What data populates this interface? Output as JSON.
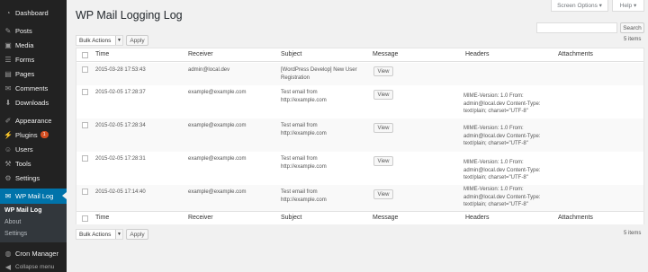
{
  "sidebar": {
    "items": [
      {
        "label": "Dashboard",
        "icon": "dashboard-icon",
        "glyph": "◔"
      },
      {
        "label": "Posts",
        "icon": "pin-icon",
        "glyph": "✎"
      },
      {
        "label": "Media",
        "icon": "media-icon",
        "glyph": "▣"
      },
      {
        "label": "Forms",
        "icon": "forms-icon",
        "glyph": "☰"
      },
      {
        "label": "Pages",
        "icon": "pages-icon",
        "glyph": "▤"
      },
      {
        "label": "Comments",
        "icon": "comments-icon",
        "glyph": "✉"
      },
      {
        "label": "Downloads",
        "icon": "download-icon",
        "glyph": "⬇"
      },
      {
        "label": "Appearance",
        "icon": "brush-icon",
        "glyph": "✐"
      },
      {
        "label": "Plugins",
        "icon": "plug-icon",
        "glyph": "⚡",
        "badge": "1"
      },
      {
        "label": "Users",
        "icon": "users-icon",
        "glyph": "☺"
      },
      {
        "label": "Tools",
        "icon": "wrench-icon",
        "glyph": "⚒"
      },
      {
        "label": "Settings",
        "icon": "settings-icon",
        "glyph": "⚙"
      },
      {
        "label": "WP Mail Log",
        "icon": "mail-icon",
        "glyph": "✉"
      },
      {
        "label": "Cron Manager",
        "icon": "globe-icon",
        "glyph": "◍"
      },
      {
        "label": "Collapse menu",
        "icon": "collapse-icon",
        "glyph": "◀"
      }
    ],
    "submenu": [
      "WP Mail Log",
      "About",
      "Settings"
    ]
  },
  "top": {
    "screen_options": "Screen Options ▾",
    "help": "Help ▾"
  },
  "page_title": "WP Mail Logging Log",
  "search_button": "Search",
  "bulk": {
    "label": "Bulk Actions",
    "apply": "Apply"
  },
  "item_count": "5 items",
  "columns": [
    "Time",
    "Receiver",
    "Subject",
    "Message",
    "Headers",
    "Attachments"
  ],
  "view_label": "View",
  "rows": [
    {
      "time": "2015-03-28 17:53:43",
      "receiver": "admin@local.dev",
      "subject": [
        "[WordPress Develop] New User",
        "Registration"
      ],
      "headers": []
    },
    {
      "time": "2015-02-05 17:28:37",
      "receiver": "example@example.com",
      "subject": [
        "Test email from",
        "http://example.com"
      ],
      "headers": [
        "MIME-Version: 1.0 From:",
        "admin@local.dev Content-Type:",
        "text/plain; charset=\"UTF-8\""
      ]
    },
    {
      "time": "2015-02-05 17:28:34",
      "receiver": "example@example.com",
      "subject": [
        "Test email from",
        "http://example.com"
      ],
      "headers": [
        "MIME-Version: 1.0 From:",
        "admin@local.dev Content-Type:",
        "text/plain; charset=\"UTF-8\""
      ]
    },
    {
      "time": "2015-02-05 17:28:31",
      "receiver": "example@example.com",
      "subject": [
        "Test email from",
        "http://example.com"
      ],
      "headers": [
        "MIME-Version: 1.0 From:",
        "admin@local.dev Content-Type:",
        "text/plain; charset=\"UTF-8\""
      ]
    },
    {
      "time": "2015-02-05 17:14:40",
      "receiver": "example@example.com",
      "subject": [
        "Test email from",
        "http://example.com"
      ],
      "headers": [
        "MIME-Version: 1.0 From:",
        "admin@local.dev Content-Type:",
        "text/plain; charset=\"UTF-8\""
      ]
    }
  ]
}
